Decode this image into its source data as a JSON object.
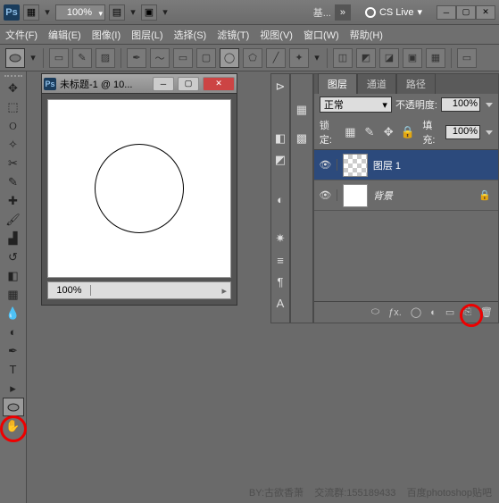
{
  "titlebar": {
    "zoom": "100%",
    "essential": "基...",
    "cslive": "CS Live"
  },
  "menus": {
    "file": "文件(F)",
    "edit": "编辑(E)",
    "image": "图像(I)",
    "layer": "图层(L)",
    "select": "选择(S)",
    "filter": "滤镜(T)",
    "view": "视图(V)",
    "window": "窗口(W)",
    "help": "帮助(H)"
  },
  "doc": {
    "title": "未标题-1 @ 10...",
    "zoom": "100%"
  },
  "panel": {
    "tabs": {
      "layers": "图层",
      "channels": "通道",
      "paths": "路径"
    },
    "mode": "正常",
    "opacityLabel": "不透明度:",
    "opacity": "100%",
    "lockLabel": "锁定:",
    "fillLabel": "填充:",
    "fill": "100%",
    "layer1": "图层 1",
    "bg": "背景"
  },
  "footer": {
    "by": "BY:古欲香萧",
    "group": "交流群:155189433",
    "baidu": "百度photoshop贴吧"
  }
}
